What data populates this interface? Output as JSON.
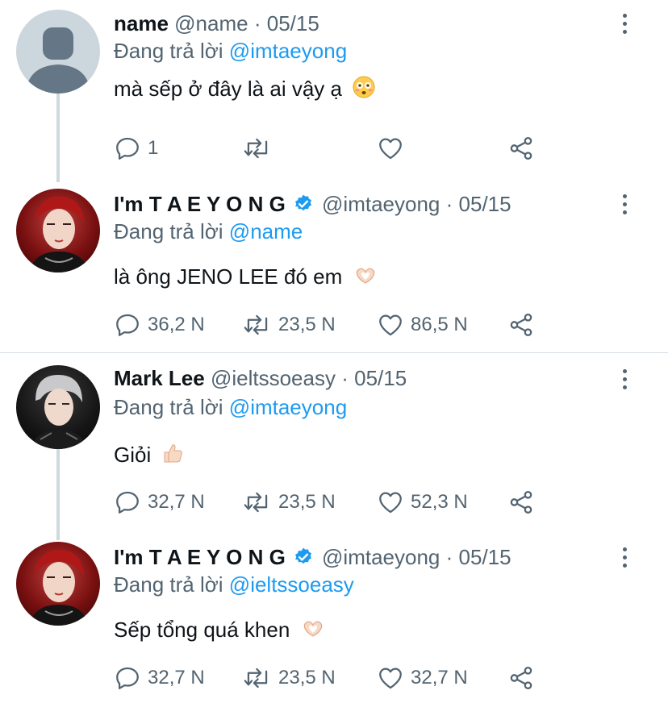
{
  "tweets": [
    {
      "display_name": "name",
      "handle": "@name",
      "date": "05/15",
      "reply_label": "Đang trả lời",
      "reply_to": "@imtaeyong",
      "text": "mà sếp ở đây là ai vậy ạ",
      "emoji": "flushed-face-emoji",
      "avatar": "default-avatar",
      "replies": "1",
      "retweets": "",
      "likes": ""
    },
    {
      "display_name": "I'm T A E Y O N G",
      "handle": "@imtaeyong",
      "date": "05/15",
      "reply_label": "Đang trả lời",
      "reply_to": "@name",
      "text": "là ông JENO LEE đó em",
      "emoji": "heart-hands-emoji",
      "avatar": "profile-photo",
      "replies": "36,2 N",
      "retweets": "23,5 N",
      "likes": "86,5 N"
    },
    {
      "display_name": "Mark Lee",
      "handle": "@ieltssoeasy",
      "date": "05/15",
      "reply_label": "Đang trả lời",
      "reply_to": "@imtaeyong",
      "text": "Giỏi",
      "emoji": "thumbs-up-emoji",
      "avatar": "profile-photo",
      "replies": "32,7 N",
      "retweets": "23,5 N",
      "likes": "52,3 N"
    },
    {
      "display_name": "I'm T A E Y O N G",
      "handle": "@imtaeyong",
      "date": "05/15",
      "reply_label": "Đang trả lời",
      "reply_to": "@ieltssoeasy",
      "text": "Sếp tổng quá khen",
      "emoji": "heart-hands-emoji",
      "avatar": "profile-photo",
      "replies": "32,7 N",
      "retweets": "23,5 N",
      "likes": "32,7 N"
    }
  ],
  "separator": "·",
  "colors": {
    "link": "#1d9bf0",
    "muted": "#536471",
    "text": "#0f1419",
    "thread_line": "#cfd9de",
    "verified": "#1d9bf0"
  }
}
